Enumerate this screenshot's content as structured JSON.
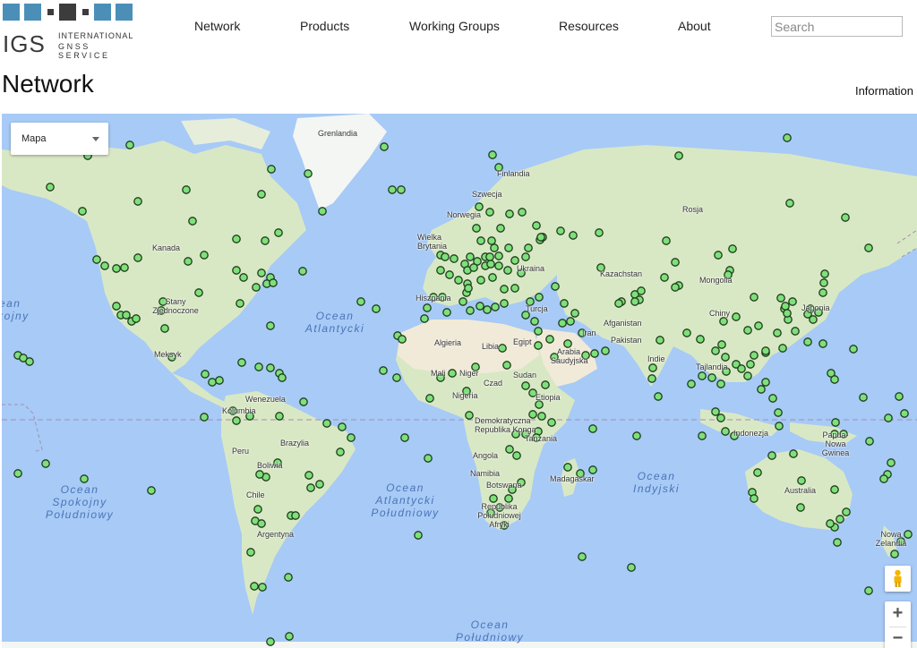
{
  "logo": {
    "abbr": "IGS",
    "line1": "INTERNATIONAL",
    "line2": "GNSS SERVICE",
    "colors": [
      "#4b8fb8",
      "#3c3c3c",
      "#3c3c3c",
      "#3c3c3c",
      "#4b8fb8",
      "#4b8fb8"
    ]
  },
  "nav": {
    "items": [
      "Network",
      "Products",
      "Working Groups",
      "Resources",
      "About"
    ]
  },
  "search": {
    "placeholder": "Search"
  },
  "page": {
    "title": "Network",
    "info_link": "Information"
  },
  "map": {
    "type_select": "Mapa",
    "zoom_in": "+",
    "zoom_out": "−",
    "colors": {
      "water": "#a7caf6",
      "land": "#d9e8c4",
      "ice": "#f4f6f4",
      "desert": "#f1ead8",
      "station_fill": "#7ee07a",
      "station_stroke": "#1f3a1c"
    },
    "country_labels": [
      "Grenlandia",
      "Finlandia",
      "Szwecja",
      "Norwegia",
      "Wielka Brytania",
      "Rosja",
      "Kanada",
      "Kazachstan",
      "Mongolia",
      "Ukraina",
      "Stany Zjednoczone",
      "Hiszpania",
      "Turcja",
      "Afganistan",
      "Chiny",
      "Japonia",
      "Iran",
      "Pakistan",
      "Algieria",
      "Libia",
      "Egipt",
      "Arabia Saudyjska",
      "Indie",
      "Tajlandia",
      "Meksyk",
      "Mali",
      "Niger",
      "Sudan",
      "Czad",
      "Nigeria",
      "Etiopia",
      "Wenezuela",
      "Kolumbia",
      "Demokratyczna Republika Konga",
      "Tanzania",
      "Indonezja",
      "Papua-Nowa Gwinea",
      "Brazylia",
      "Peru",
      "Boliwia",
      "Angola",
      "Namibia",
      "Botswana",
      "Madagaskar",
      "Australia",
      "Chile",
      "Republika Południowej Afryki",
      "Argentyna",
      "Nowa Zelandia"
    ],
    "ocean_labels": [
      "Ocean Atlantycki",
      "Ocean Spokojny",
      "Ocean Spokojny Południowy",
      "Ocean Atlantycki Południowy",
      "Ocean Indyjski",
      "Ocean Południowy"
    ]
  }
}
